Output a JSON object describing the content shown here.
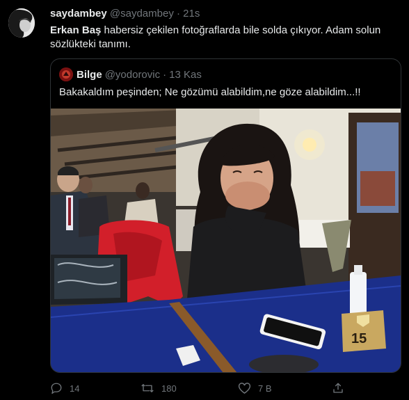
{
  "tweet": {
    "author_name": "saydambey",
    "author_handle": "@saydambey",
    "separator": "·",
    "time": "21s",
    "text_bold": "Erkan Baş",
    "text_rest": " habersiz çekilen fotoğraflarda bile solda çıkıyor. Adam solun sözlükteki tanımı."
  },
  "quote": {
    "author_name": "Bilge",
    "author_handle": "@yodorovic",
    "separator": "·",
    "date": "13 Kas",
    "text": "Bakakaldım peşinden; Ne gözümü alabildim,ne göze alabildim...!!",
    "image_sign_number": "15"
  },
  "actions": {
    "reply_count": "14",
    "retweet_count": "180",
    "like_count": "7 B",
    "icons": [
      "reply-icon",
      "retweet-icon",
      "like-icon",
      "share-icon"
    ]
  },
  "colors": {
    "background": "#000000",
    "text_primary": "#e7e9ea",
    "text_secondary": "#71767b",
    "border": "#2f3336"
  }
}
